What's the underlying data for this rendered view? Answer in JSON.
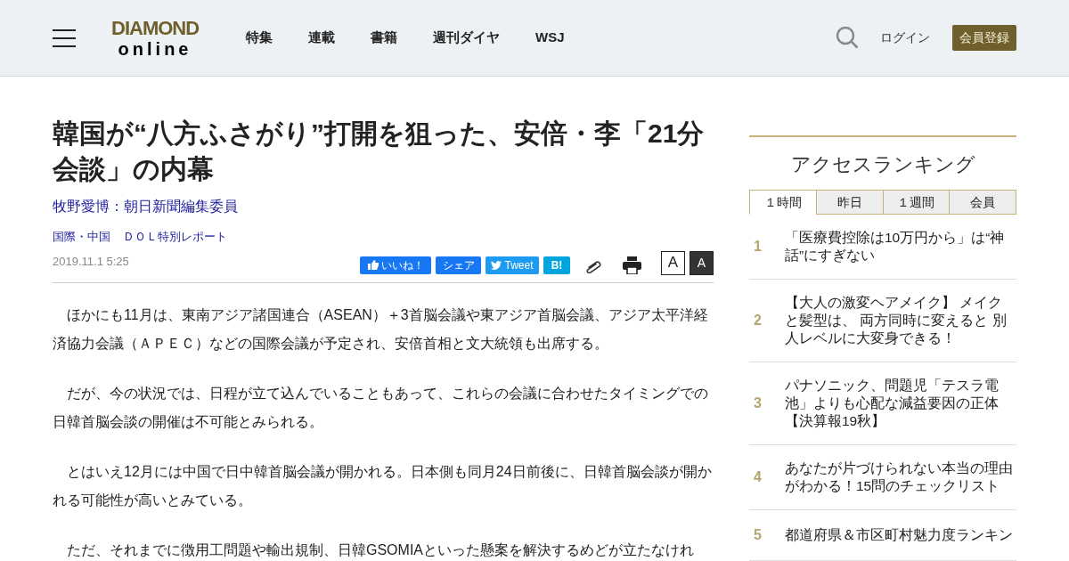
{
  "header": {
    "logo": {
      "top": "DIAMOND",
      "bottom": "online"
    },
    "nav": [
      "特集",
      "連載",
      "書籍",
      "週刊ダイヤ",
      "WSJ"
    ],
    "login": "ログイン",
    "register": "会員登録"
  },
  "article": {
    "title": "韓国が“八方ふさがり”打開を狙った、安倍・李「21分会談」の内幕",
    "author": "牧野愛博：朝日新聞編集委員",
    "categories": [
      "国際・中国",
      "ＤＯＬ特別レポート"
    ],
    "date": "2019.11.1 5:25",
    "share": [
      {
        "kind": "like",
        "label": "いいね！"
      },
      {
        "kind": "share",
        "label": "シェア"
      },
      {
        "kind": "tweet",
        "label": "Tweet"
      },
      {
        "kind": "hatena",
        "label": "B!"
      }
    ],
    "font_sizes": [
      {
        "label": "A",
        "selected": false
      },
      {
        "label": "A",
        "selected": true
      }
    ],
    "paragraphs": [
      "　ほかにも11月は、東南アジア諸国連合（ASEAN）＋3首脳会議や東アジア首脳会議、アジア太平洋経済協力会議（ＡＰＥＣ）などの国際会議が予定され、安倍首相と文大統領も出席する。",
      "　だが、今の状況では、日程が立て込んでいることもあって、これらの会議に合わせたタイミングでの日韓首脳会談の開催は不可能とみられる。",
      "　とはいえ12月には中国で日中韓首脳会議が開かれる。日本側も同月24日前後に、日韓首脳会談が開かれる可能性が高いとみている。",
      "　ただ、それまでに徴用工問題や輸出規制、日韓GSOMIAといった懸案を解決するめどが立たなけれ"
    ]
  },
  "ranking": {
    "title": "アクセスランキング",
    "tabs": [
      {
        "label": "１時間",
        "selected": true
      },
      {
        "label": "昨日",
        "selected": false
      },
      {
        "label": "１週間",
        "selected": false
      },
      {
        "label": "会員",
        "selected": false
      }
    ],
    "items": [
      {
        "rank": "1",
        "title": "「医療費控除は10万円から」は“神話”にすぎない"
      },
      {
        "rank": "2",
        "title": "【大人の激変ヘアメイク】 メイクと髪型は、 両方同時に変えると 別人レベルに大変身できる！"
      },
      {
        "rank": "3",
        "title": "パナソニック、問題児「テスラ電池」よりも心配な減益要因の正体【決算報19秋】"
      },
      {
        "rank": "4",
        "title": "あなたが片づけられない本当の理由がわかる！15問のチェックリスト"
      },
      {
        "rank": "5",
        "title": "都道府県＆市区町村魅力度ランキン"
      }
    ]
  }
}
